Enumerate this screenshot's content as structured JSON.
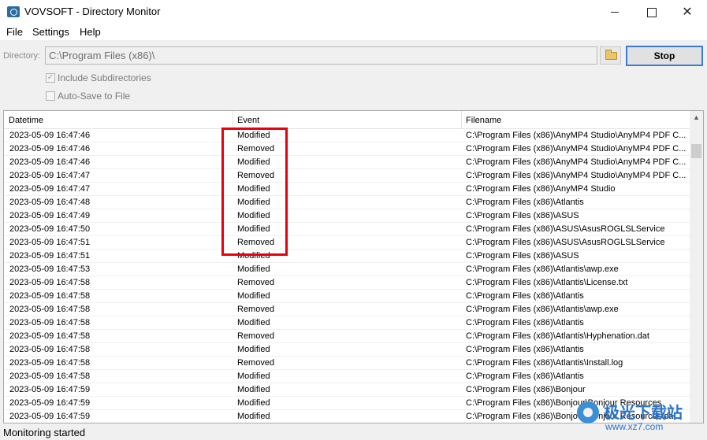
{
  "window": {
    "title": "VOVSOFT - Directory Monitor",
    "minimize_glyph": "",
    "maximize_glyph": "",
    "close_glyph": "✕"
  },
  "menu": [
    "File",
    "Settings",
    "Help"
  ],
  "directory": {
    "label": "Directory:",
    "value": "C:\\Program Files (x86)\\",
    "browse_icon": "folder-icon",
    "stop_label": "Stop"
  },
  "options": {
    "include_subdirectories": {
      "label": "Include Subdirectories",
      "checked": true
    },
    "auto_save": {
      "label": "Auto-Save to File",
      "checked": false
    }
  },
  "table": {
    "columns": [
      "Datetime",
      "Event",
      "Filename"
    ],
    "rows": [
      [
        "2023-05-09 16:47:46",
        "Modified",
        "C:\\Program Files (x86)\\AnyMP4 Studio\\AnyMP4 PDF C..."
      ],
      [
        "2023-05-09 16:47:46",
        "Removed",
        "C:\\Program Files (x86)\\AnyMP4 Studio\\AnyMP4 PDF C..."
      ],
      [
        "2023-05-09 16:47:46",
        "Modified",
        "C:\\Program Files (x86)\\AnyMP4 Studio\\AnyMP4 PDF C..."
      ],
      [
        "2023-05-09 16:47:47",
        "Removed",
        "C:\\Program Files (x86)\\AnyMP4 Studio\\AnyMP4 PDF C..."
      ],
      [
        "2023-05-09 16:47:47",
        "Modified",
        "C:\\Program Files (x86)\\AnyMP4 Studio"
      ],
      [
        "2023-05-09 16:47:48",
        "Modified",
        "C:\\Program Files (x86)\\Atlantis"
      ],
      [
        "2023-05-09 16:47:49",
        "Modified",
        "C:\\Program Files (x86)\\ASUS"
      ],
      [
        "2023-05-09 16:47:50",
        "Modified",
        "C:\\Program Files (x86)\\ASUS\\AsusROGLSLService"
      ],
      [
        "2023-05-09 16:47:51",
        "Removed",
        "C:\\Program Files (x86)\\ASUS\\AsusROGLSLService"
      ],
      [
        "2023-05-09 16:47:51",
        "Modified",
        "C:\\Program Files (x86)\\ASUS"
      ],
      [
        "2023-05-09 16:47:53",
        "Modified",
        "C:\\Program Files (x86)\\Atlantis\\awp.exe"
      ],
      [
        "2023-05-09 16:47:58",
        "Removed",
        "C:\\Program Files (x86)\\Atlantis\\License.txt"
      ],
      [
        "2023-05-09 16:47:58",
        "Modified",
        "C:\\Program Files (x86)\\Atlantis"
      ],
      [
        "2023-05-09 16:47:58",
        "Removed",
        "C:\\Program Files (x86)\\Atlantis\\awp.exe"
      ],
      [
        "2023-05-09 16:47:58",
        "Modified",
        "C:\\Program Files (x86)\\Atlantis"
      ],
      [
        "2023-05-09 16:47:58",
        "Removed",
        "C:\\Program Files (x86)\\Atlantis\\Hyphenation.dat"
      ],
      [
        "2023-05-09 16:47:58",
        "Modified",
        "C:\\Program Files (x86)\\Atlantis"
      ],
      [
        "2023-05-09 16:47:58",
        "Removed",
        "C:\\Program Files (x86)\\Atlantis\\Install.log"
      ],
      [
        "2023-05-09 16:47:58",
        "Modified",
        "C:\\Program Files (x86)\\Atlantis"
      ],
      [
        "2023-05-09 16:47:59",
        "Modified",
        "C:\\Program Files (x86)\\Bonjour"
      ],
      [
        "2023-05-09 16:47:59",
        "Modified",
        "C:\\Program Files (x86)\\Bonjour\\Bonjour Resources"
      ],
      [
        "2023-05-09 16:47:59",
        "Modified",
        "C:\\Program Files (x86)\\Bonjour\\Bonjour Resources\\da..."
      ]
    ]
  },
  "scrollbar": {
    "up_glyph": "▲"
  },
  "status": "Monitoring started",
  "watermark": {
    "title": "极光下载站",
    "url": "www.xz7.com"
  },
  "colors": {
    "highlight": "#e8000b",
    "stop_border": "#3c7bd6",
    "watermark": "#2b73c7"
  }
}
